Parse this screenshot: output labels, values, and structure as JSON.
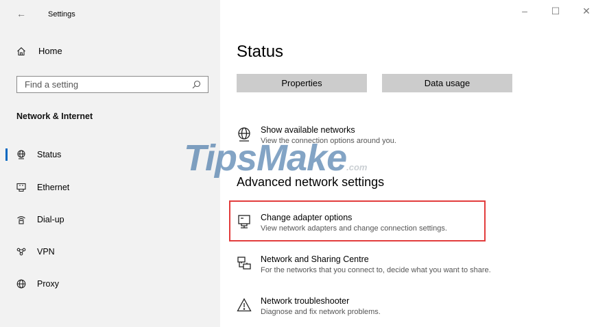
{
  "window": {
    "title": "Settings",
    "controls": {
      "minimize": "–",
      "maximize": "☐",
      "close": "✕"
    }
  },
  "sidebar": {
    "back_icon": "←",
    "home_label": "Home",
    "search_placeholder": "Find a setting",
    "section_title": "Network & Internet",
    "items": [
      {
        "label": "Status",
        "icon": "globe-status-icon",
        "selected": true
      },
      {
        "label": "Ethernet",
        "icon": "ethernet-icon",
        "selected": false
      },
      {
        "label": "Dial-up",
        "icon": "dialup-icon",
        "selected": false
      },
      {
        "label": "VPN",
        "icon": "vpn-icon",
        "selected": false
      },
      {
        "label": "Proxy",
        "icon": "globe-icon",
        "selected": false
      }
    ]
  },
  "main": {
    "title": "Status",
    "buttons": {
      "properties": "Properties",
      "data_usage": "Data usage"
    },
    "show_networks": {
      "title": "Show available networks",
      "desc": "View the connection options around you."
    },
    "advanced_heading": "Advanced network settings",
    "options": [
      {
        "title": "Change adapter options",
        "desc": "View network adapters and change connection settings.",
        "icon": "adapter-icon",
        "highlighted": true
      },
      {
        "title": "Network and Sharing Centre",
        "desc": "For the networks that you connect to, decide what you want to share.",
        "icon": "sharing-centre-icon",
        "highlighted": false
      },
      {
        "title": "Network troubleshooter",
        "desc": "Diagnose and fix network problems.",
        "icon": "warning-icon",
        "highlighted": false
      }
    ]
  },
  "watermark": {
    "text": "TipsMake",
    "suffix": ".com"
  },
  "colors": {
    "sidebar_bg": "#f2f2f2",
    "accent": "#0067c0",
    "highlight": "#e23b3b",
    "button_bg": "#cccccc"
  }
}
